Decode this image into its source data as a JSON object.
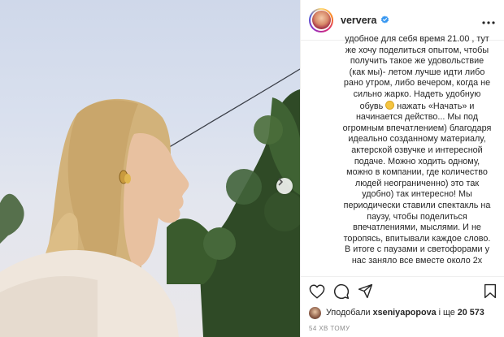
{
  "post": {
    "username": "ververa",
    "verified": true,
    "caption_lines": [
      "удобное для себя время 21.00 , тут",
      "же хочу поделиться опытом, чтобы",
      "получить такое же удовольствие",
      "(как мы)- летом лучше идти либо",
      "рано утром, либо вечером, когда не",
      "сильно жарко. Надеть удобную",
      "обувь",
      "нажать «Начать» и",
      "начинается действо... Мы под",
      "огромным впечатлением) благодаря",
      "идеально созданному материалу,",
      "актерской озвучке и интересной",
      "подаче. Можно ходить одному,",
      "можно в компании, где количество",
      "людей неограниченно) это так",
      "удобно) так интересно! Мы",
      "периодически ставили спектакль на",
      "паузу, чтобы поделиться",
      "впечатлениями, мыслями. И не",
      "торопясь, впитывали каждое слово.",
      "В итоге с паузами и светофорами у",
      "нас заняло все вместе около 2х"
    ],
    "caption_emoji": "slightly-smiling-face-emoji",
    "likes": {
      "prefix": "Уподобали",
      "liker": "xseniyapopova",
      "middle": "і ще",
      "count": "20 573"
    },
    "timestamp": "54 ХВ ТОМУ"
  },
  "icons": {
    "verified": "verified-badge-icon",
    "more": "more-options-icon",
    "like": "heart-icon",
    "comment": "comment-icon",
    "share": "paper-plane-icon",
    "save": "bookmark-icon",
    "next": "chevron-right-icon"
  },
  "colors": {
    "verified": "#3897f0",
    "text": "#262626",
    "muted": "#8e8e8e",
    "border": "#efefef"
  }
}
